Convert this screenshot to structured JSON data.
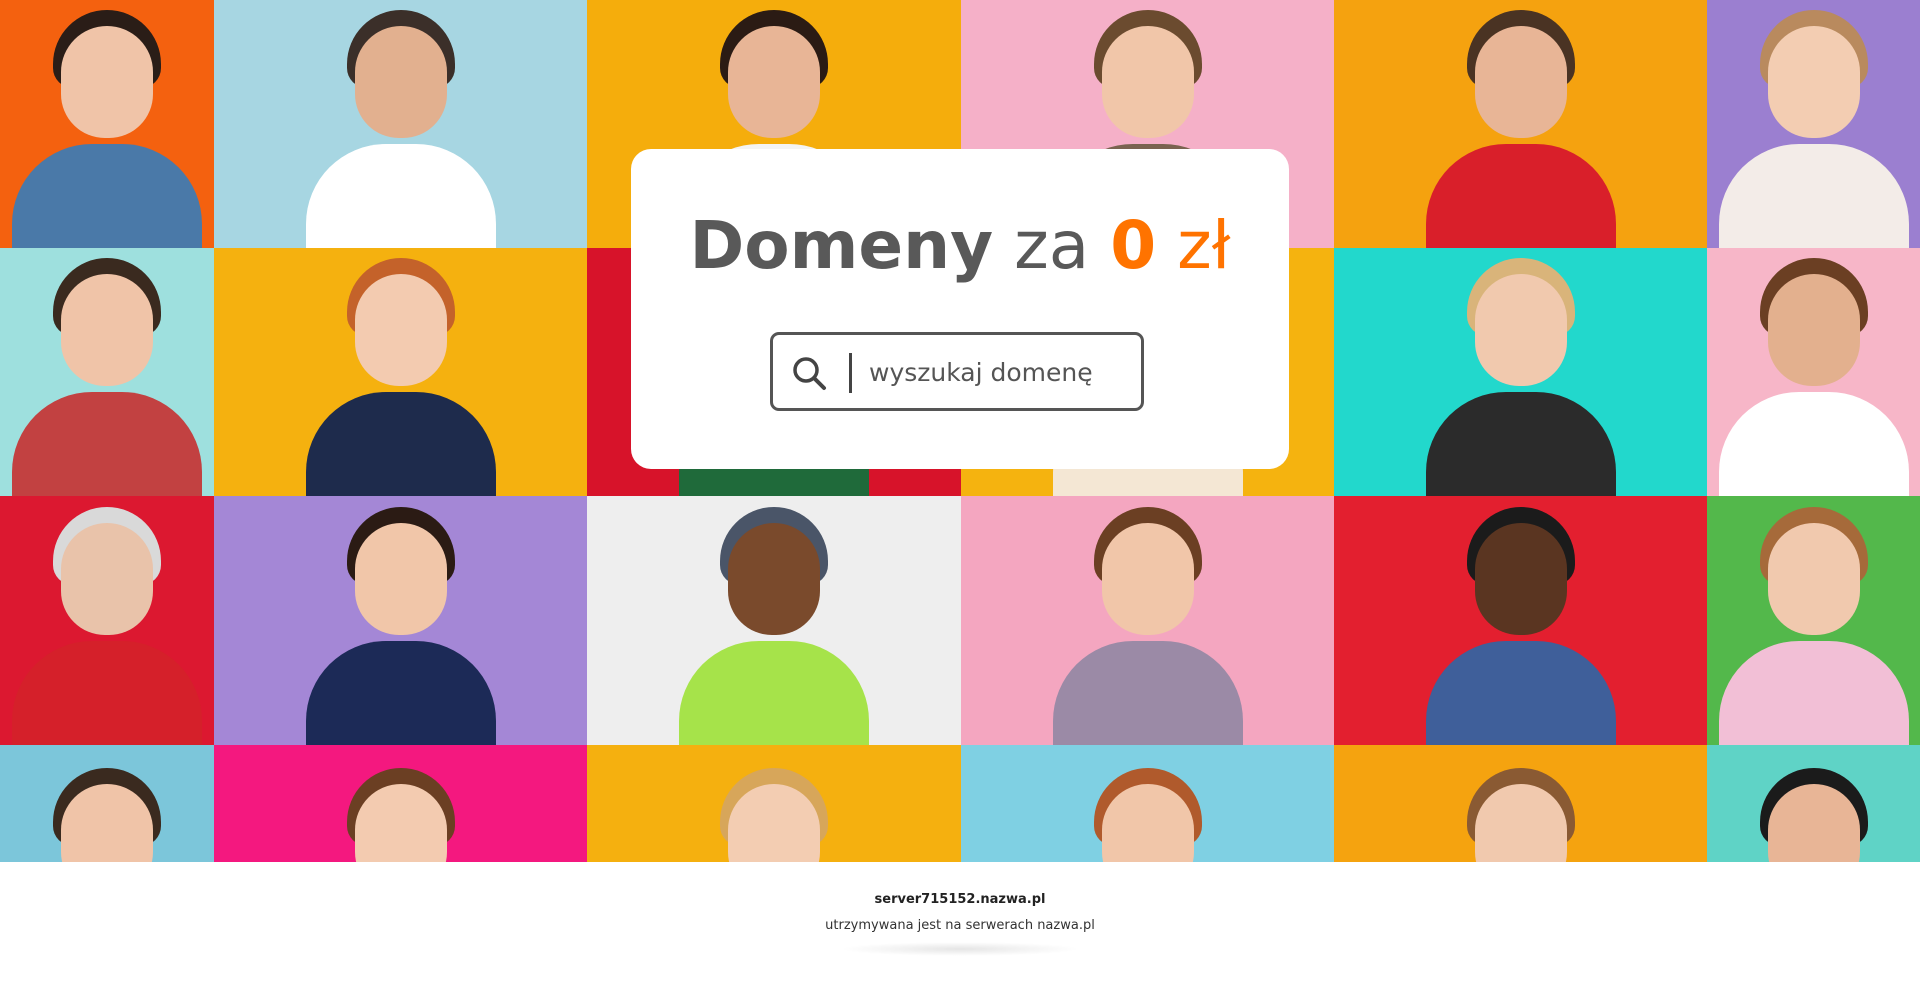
{
  "hero": {
    "title_bold": "Domeny",
    "title_light": "za",
    "title_price": "0",
    "title_currency": "zł",
    "accent_color": "#ff7300",
    "text_color": "#595959"
  },
  "search": {
    "placeholder": "wyszukaj domenę",
    "value": "",
    "icon": "search-icon"
  },
  "footer": {
    "hostname": "server715152.nazwa.pl",
    "hosted_text": "utrzymywana jest na serwerach nazwa.pl"
  },
  "photo_grid": {
    "rows": [
      [
        "#f4610f",
        "#a7d6e2",
        "#f5ad0c",
        "#f5b0c8",
        "#f5a20f",
        "#9b7fd0"
      ],
      [
        "#9ee0de",
        "#f5b10f",
        "#d7132a",
        "#f5b30f",
        "#22d8cc",
        "#f7b6c8"
      ],
      [
        "#dc1830",
        "#a487d6",
        "#eeeeee",
        "#f4a6c0",
        "#e31f2f",
        "#53b84b"
      ],
      [
        "#7cc6da",
        "#f4187f",
        "#f5b00f",
        "#7fd0e3",
        "#f5a30f",
        "#5fd3c6"
      ]
    ],
    "clothing": [
      [
        "#4a79a8",
        "#ffffff",
        "#f4f4f4",
        "#7a6350",
        "#d91f2a",
        "#f3ece8"
      ],
      [
        "#c24141",
        "#1e2b4c",
        "#1f6a3a",
        "#f4e7d4",
        "#2b2b2b",
        "#ffffff"
      ],
      [
        "#d5202a",
        "#1c2a57",
        "#a6e34a",
        "#9b8aa6",
        "#3f5f9a",
        "#f2bfd6"
      ],
      [
        "#e7d3b6",
        "#f3c6cd",
        "#ffd9e2",
        "#c7e6ef",
        "#f4b970",
        "#2d2d2d"
      ]
    ],
    "hair": [
      [
        "#2a1d17",
        "#3b2f29",
        "#2b1b14",
        "#6b4b2f",
        "#4a3323",
        "#b98a5e"
      ],
      [
        "#3a2a1f",
        "#c4622a",
        "#2b1b14",
        "#6b4b2f",
        "#d9b47a",
        "#6b3f23"
      ],
      [
        "#d9d9d9",
        "#2b1b14",
        "#4a5568",
        "#6b3f23",
        "#1b1b1b",
        "#a66a3a"
      ],
      [
        "#3a2a1f",
        "#6b3f23",
        "#d7a65a",
        "#b05a2c",
        "#8a5a33",
        "#1b1b1b"
      ]
    ],
    "skin": [
      [
        "#f0c4a8",
        "#e2b08f",
        "#e8b596",
        "#f1c6a9",
        "#e8b596",
        "#f3cdb2"
      ],
      [
        "#f0c4a8",
        "#f3cbb0",
        "#e8b596",
        "#f1c6a9",
        "#f1c9ae",
        "#e3b08e"
      ],
      [
        "#e9c3aa",
        "#f1c6a9",
        "#7a4a2c",
        "#f1c6a9",
        "#5a3521",
        "#f1c9ae"
      ],
      [
        "#f0c4a8",
        "#f3cbb0",
        "#f3cdb2",
        "#f1c6a9",
        "#f1c9ae",
        "#e8b596"
      ]
    ]
  }
}
